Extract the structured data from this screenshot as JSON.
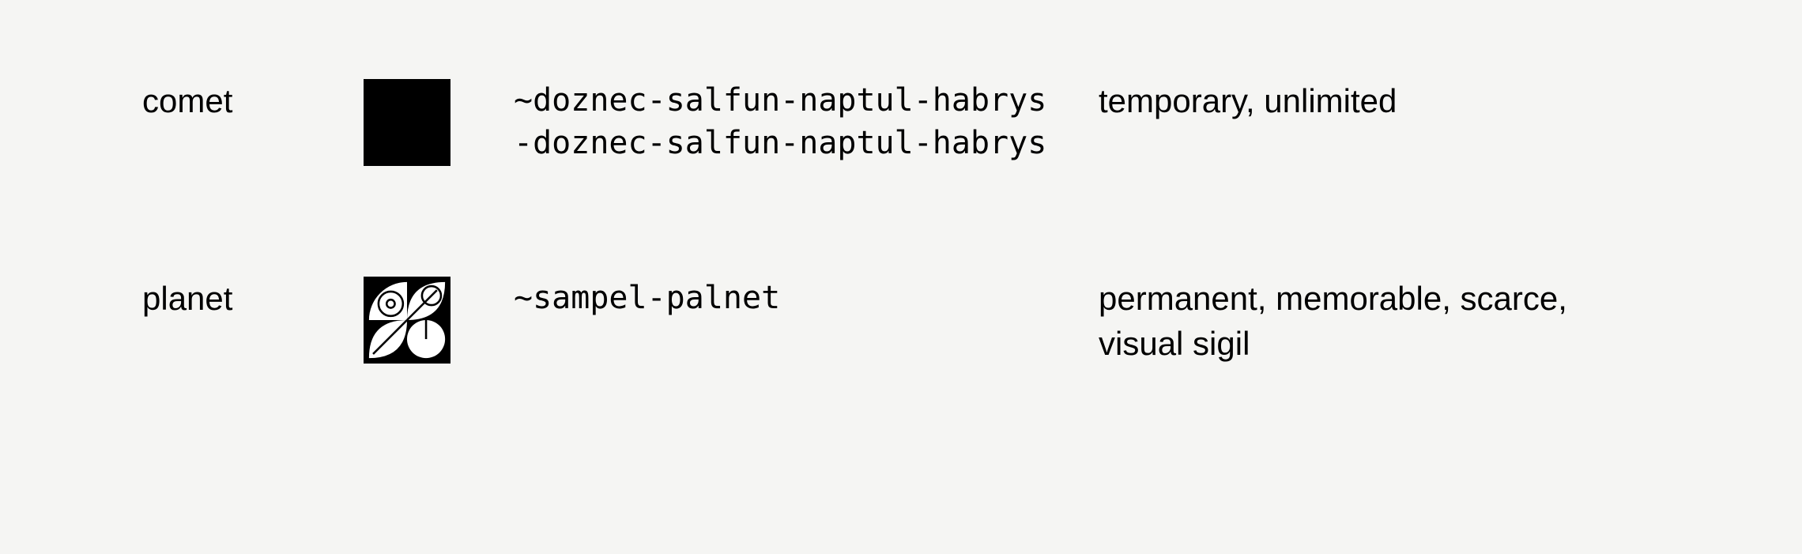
{
  "rows": [
    {
      "label": "comet",
      "sigil": "comet-sigil",
      "name": "~doznec-salfun-naptul-habrys\n-doznec-salfun-naptul-habrys",
      "desc": "temporary, unlimited"
    },
    {
      "label": "planet",
      "sigil": "planet-sigil",
      "name": "~sampel-palnet",
      "desc": "permanent, memorable, scarce, visual sigil"
    }
  ]
}
